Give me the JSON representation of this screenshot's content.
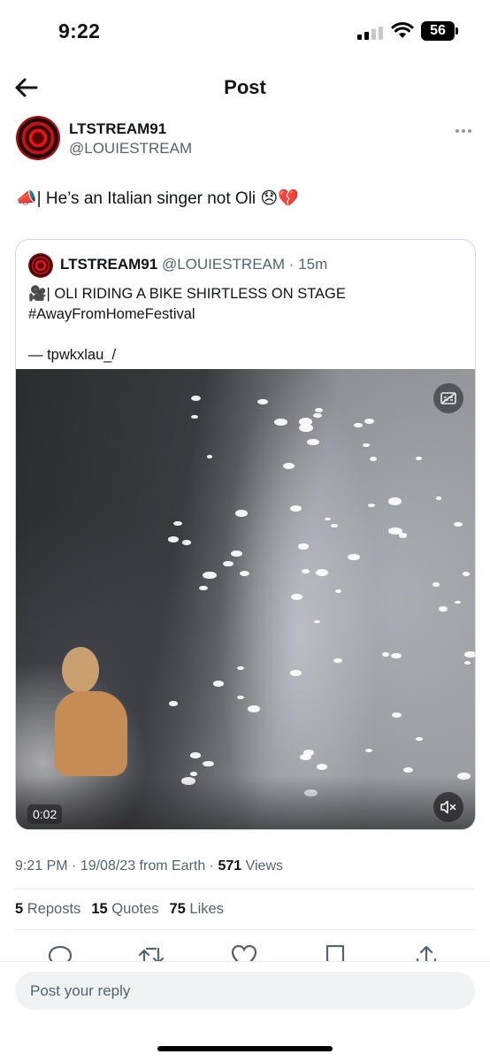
{
  "status_bar": {
    "time": "9:22",
    "battery": "56",
    "icons": [
      "cellular-signal-icon",
      "wifi-icon",
      "battery-icon"
    ]
  },
  "nav": {
    "title": "Post",
    "back_icon": "arrow-left-icon"
  },
  "post": {
    "author_name": "LTSTREAM91",
    "author_handle": "@LOUIESTREAM",
    "text": "📣| He’s an Italian singer not Oli 😞💔",
    "more_icon": "more-horizontal-icon"
  },
  "quoted_post": {
    "author_name": "LTSTREAM91",
    "author_handle": "@LOUIESTREAM",
    "time": "15m",
    "separator": "·",
    "text_lines": [
      "🎥| OLI RIDING A BIKE SHIRTLESS ON STAGE",
      "#AwayFromHomeFestival",
      "",
      "— tpwkxlau_/"
    ],
    "video": {
      "duration": "0:02",
      "caption_icon": "captions-icon",
      "mute_icon": "volume-muted-icon"
    }
  },
  "meta": {
    "time": "9:21 PM",
    "date": "19/08/23",
    "source": "from Earth",
    "views_count": "571",
    "views_label": "Views"
  },
  "stats": {
    "reposts_count": "5",
    "reposts_label": "Reposts",
    "quotes_count": "15",
    "quotes_label": "Quotes",
    "likes_count": "75",
    "likes_label": "Likes"
  },
  "actions": [
    "reply-icon",
    "repost-icon",
    "like-icon",
    "bookmark-icon",
    "share-icon"
  ],
  "reply": {
    "placeholder": "Post your reply"
  },
  "colors": {
    "text": "#0f1419",
    "secondary": "#536471",
    "border": "#cfd9de",
    "input_bg": "#eff3f4"
  }
}
